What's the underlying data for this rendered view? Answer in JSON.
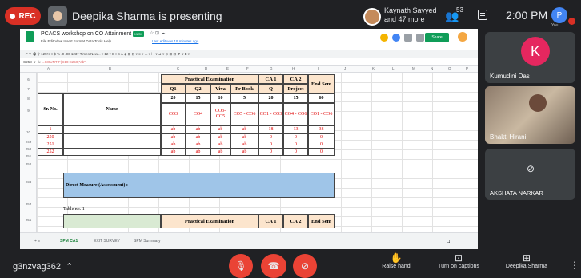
{
  "top_bar": {
    "rec_label": "REC",
    "presenter_title": "Deepika Sharma is presenting",
    "participants_line1": "Kaynath Sayyed",
    "participants_line2": "and 47 more",
    "people_count": "53",
    "time": "2:00 PM",
    "you_label": "You",
    "you_initial": "P"
  },
  "sheet": {
    "title": "PCACS workshop on CO Attainment",
    "badge": "XLSX",
    "menu": "File  Edit  View  Insert  Format  Data  Tools  Help",
    "last_edit": "Last edit was 19 minutes ago",
    "share_label": "Share",
    "toolbar": "↶  ↷  🖶  ⚲   125% ▾   $  %  .0  .00  123▾   Times New... ▾   12  ▾   B  I  S  A   ◈  ⊞  ⊟ ▾   ≡ ▾  ⊥ ▾  ⊢ ▾  ⊿ ▾   ⊝  ⊞  ⊟  ▼ ▾  Σ ▾",
    "cell_ref": "C258",
    "formula": "=COUNTIF(C10:C250,\"ab\")",
    "columns": [
      "A",
      "B",
      "C",
      "D",
      "E",
      "F",
      "G",
      "H",
      "I",
      "J",
      "K",
      "L",
      "M",
      "N",
      "O",
      "P"
    ],
    "rows": [
      "6",
      "7",
      "8",
      "9",
      "10",
      "249",
      "250",
      "251",
      "252",
      "253",
      "254",
      "255"
    ],
    "table": {
      "practical_exam": "Practical Examination",
      "ca1": "CA 1",
      "ca2": "CA 2",
      "end_sem": "End Sem",
      "sr_no": "Sr. No.",
      "name": "Name",
      "sub": [
        "Q1",
        "Q2",
        "Viva",
        "Pr Book",
        "Q",
        "Project"
      ],
      "max": [
        "20",
        "15",
        "10",
        "5",
        "20",
        "15",
        "60"
      ],
      "co": [
        "CO3",
        "CO4",
        "CO3-CO5",
        "CO5 - CO6",
        "CO1 - CO3",
        "CO4 - CO6",
        "CO1 - CO6"
      ],
      "data_rows": [
        {
          "sr": "1",
          "vals": [
            "ab",
            "ab",
            "ab",
            "ab",
            "18",
            "13",
            "38"
          ]
        },
        {
          "sr": "250",
          "vals": [
            "ab",
            "ab",
            "ab",
            "ab",
            "0",
            "0",
            "0"
          ]
        },
        {
          "sr": "251",
          "vals": [
            "ab",
            "ab",
            "ab",
            "ab",
            "0",
            "0",
            "0"
          ]
        },
        {
          "sr": "252",
          "vals": [
            "ab",
            "ab",
            "ab",
            "ab",
            "0",
            "0",
            "0"
          ]
        }
      ],
      "direct_measure": "Direct Measure (Assessment) :-",
      "table_no": "Table no. 1"
    },
    "tabs": [
      "SPM CA1",
      "EXIT SURVEY",
      "SPM Summary"
    ]
  },
  "right_panel": {
    "tile1_name": "Kumudini Das",
    "tile1_initial": "K",
    "tile2_name": "Bhakti Hirani",
    "tile3_name": "AKSHATA NARKAR"
  },
  "bottom_bar": {
    "meeting_code": "g3nzvag362",
    "raise_hand": "Raise hand",
    "captions": "Turn on captions",
    "presenting": "Deepika Sharma"
  }
}
